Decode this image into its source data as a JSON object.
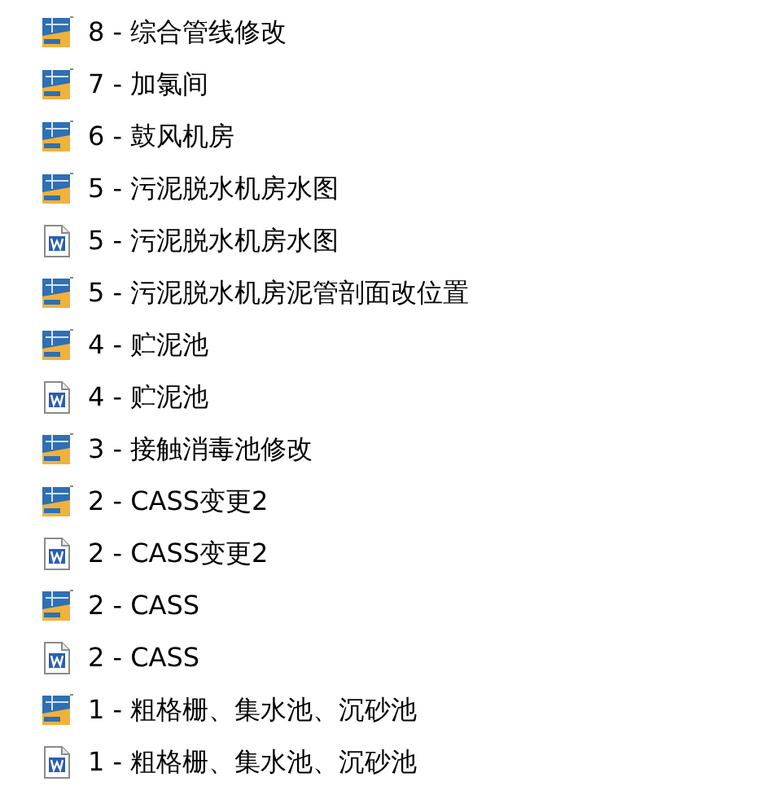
{
  "files": [
    {
      "kind": "dwg",
      "name": "8 - 综合管线修改"
    },
    {
      "kind": "dwg",
      "name": "7 - 加氯间"
    },
    {
      "kind": "dwg",
      "name": "6 - 鼓风机房"
    },
    {
      "kind": "dwg",
      "name": "5 - 污泥脱水机房水图"
    },
    {
      "kind": "doc",
      "name": "5 - 污泥脱水机房水图"
    },
    {
      "kind": "dwg",
      "name": "5 - 污泥脱水机房泥管剖面改位置"
    },
    {
      "kind": "dwg",
      "name": "4 - 贮泥池"
    },
    {
      "kind": "doc",
      "name": "4 - 贮泥池"
    },
    {
      "kind": "dwg",
      "name": "3 - 接触消毒池修改"
    },
    {
      "kind": "dwg",
      "name": "2 - CASS变更2"
    },
    {
      "kind": "doc",
      "name": "2 - CASS变更2"
    },
    {
      "kind": "dwg",
      "name": "2 - CASS"
    },
    {
      "kind": "doc",
      "name": "2 - CASS"
    },
    {
      "kind": "dwg",
      "name": "1 - 粗格栅、集水池、沉砂池"
    },
    {
      "kind": "doc",
      "name": "1 - 粗格栅、集水池、沉砂池"
    }
  ]
}
